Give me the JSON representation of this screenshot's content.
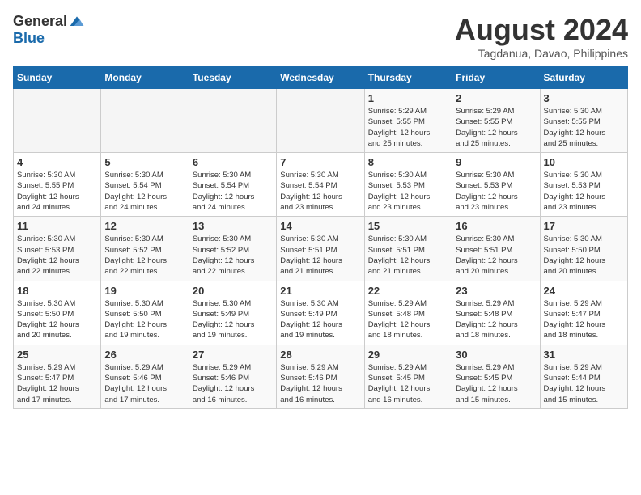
{
  "logo": {
    "general": "General",
    "blue": "Blue"
  },
  "title": "August 2024",
  "location": "Tagdanua, Davao, Philippines",
  "days": [
    "Sunday",
    "Monday",
    "Tuesday",
    "Wednesday",
    "Thursday",
    "Friday",
    "Saturday"
  ],
  "weeks": [
    [
      {
        "date": "",
        "info": ""
      },
      {
        "date": "",
        "info": ""
      },
      {
        "date": "",
        "info": ""
      },
      {
        "date": "",
        "info": ""
      },
      {
        "date": "1",
        "info": "Sunrise: 5:29 AM\nSunset: 5:55 PM\nDaylight: 12 hours\nand 25 minutes."
      },
      {
        "date": "2",
        "info": "Sunrise: 5:29 AM\nSunset: 5:55 PM\nDaylight: 12 hours\nand 25 minutes."
      },
      {
        "date": "3",
        "info": "Sunrise: 5:30 AM\nSunset: 5:55 PM\nDaylight: 12 hours\nand 25 minutes."
      }
    ],
    [
      {
        "date": "4",
        "info": "Sunrise: 5:30 AM\nSunset: 5:55 PM\nDaylight: 12 hours\nand 24 minutes."
      },
      {
        "date": "5",
        "info": "Sunrise: 5:30 AM\nSunset: 5:54 PM\nDaylight: 12 hours\nand 24 minutes."
      },
      {
        "date": "6",
        "info": "Sunrise: 5:30 AM\nSunset: 5:54 PM\nDaylight: 12 hours\nand 24 minutes."
      },
      {
        "date": "7",
        "info": "Sunrise: 5:30 AM\nSunset: 5:54 PM\nDaylight: 12 hours\nand 23 minutes."
      },
      {
        "date": "8",
        "info": "Sunrise: 5:30 AM\nSunset: 5:53 PM\nDaylight: 12 hours\nand 23 minutes."
      },
      {
        "date": "9",
        "info": "Sunrise: 5:30 AM\nSunset: 5:53 PM\nDaylight: 12 hours\nand 23 minutes."
      },
      {
        "date": "10",
        "info": "Sunrise: 5:30 AM\nSunset: 5:53 PM\nDaylight: 12 hours\nand 23 minutes."
      }
    ],
    [
      {
        "date": "11",
        "info": "Sunrise: 5:30 AM\nSunset: 5:53 PM\nDaylight: 12 hours\nand 22 minutes."
      },
      {
        "date": "12",
        "info": "Sunrise: 5:30 AM\nSunset: 5:52 PM\nDaylight: 12 hours\nand 22 minutes."
      },
      {
        "date": "13",
        "info": "Sunrise: 5:30 AM\nSunset: 5:52 PM\nDaylight: 12 hours\nand 22 minutes."
      },
      {
        "date": "14",
        "info": "Sunrise: 5:30 AM\nSunset: 5:51 PM\nDaylight: 12 hours\nand 21 minutes."
      },
      {
        "date": "15",
        "info": "Sunrise: 5:30 AM\nSunset: 5:51 PM\nDaylight: 12 hours\nand 21 minutes."
      },
      {
        "date": "16",
        "info": "Sunrise: 5:30 AM\nSunset: 5:51 PM\nDaylight: 12 hours\nand 20 minutes."
      },
      {
        "date": "17",
        "info": "Sunrise: 5:30 AM\nSunset: 5:50 PM\nDaylight: 12 hours\nand 20 minutes."
      }
    ],
    [
      {
        "date": "18",
        "info": "Sunrise: 5:30 AM\nSunset: 5:50 PM\nDaylight: 12 hours\nand 20 minutes."
      },
      {
        "date": "19",
        "info": "Sunrise: 5:30 AM\nSunset: 5:50 PM\nDaylight: 12 hours\nand 19 minutes."
      },
      {
        "date": "20",
        "info": "Sunrise: 5:30 AM\nSunset: 5:49 PM\nDaylight: 12 hours\nand 19 minutes."
      },
      {
        "date": "21",
        "info": "Sunrise: 5:30 AM\nSunset: 5:49 PM\nDaylight: 12 hours\nand 19 minutes."
      },
      {
        "date": "22",
        "info": "Sunrise: 5:29 AM\nSunset: 5:48 PM\nDaylight: 12 hours\nand 18 minutes."
      },
      {
        "date": "23",
        "info": "Sunrise: 5:29 AM\nSunset: 5:48 PM\nDaylight: 12 hours\nand 18 minutes."
      },
      {
        "date": "24",
        "info": "Sunrise: 5:29 AM\nSunset: 5:47 PM\nDaylight: 12 hours\nand 18 minutes."
      }
    ],
    [
      {
        "date": "25",
        "info": "Sunrise: 5:29 AM\nSunset: 5:47 PM\nDaylight: 12 hours\nand 17 minutes."
      },
      {
        "date": "26",
        "info": "Sunrise: 5:29 AM\nSunset: 5:46 PM\nDaylight: 12 hours\nand 17 minutes."
      },
      {
        "date": "27",
        "info": "Sunrise: 5:29 AM\nSunset: 5:46 PM\nDaylight: 12 hours\nand 16 minutes."
      },
      {
        "date": "28",
        "info": "Sunrise: 5:29 AM\nSunset: 5:46 PM\nDaylight: 12 hours\nand 16 minutes."
      },
      {
        "date": "29",
        "info": "Sunrise: 5:29 AM\nSunset: 5:45 PM\nDaylight: 12 hours\nand 16 minutes."
      },
      {
        "date": "30",
        "info": "Sunrise: 5:29 AM\nSunset: 5:45 PM\nDaylight: 12 hours\nand 15 minutes."
      },
      {
        "date": "31",
        "info": "Sunrise: 5:29 AM\nSunset: 5:44 PM\nDaylight: 12 hours\nand 15 minutes."
      }
    ]
  ]
}
